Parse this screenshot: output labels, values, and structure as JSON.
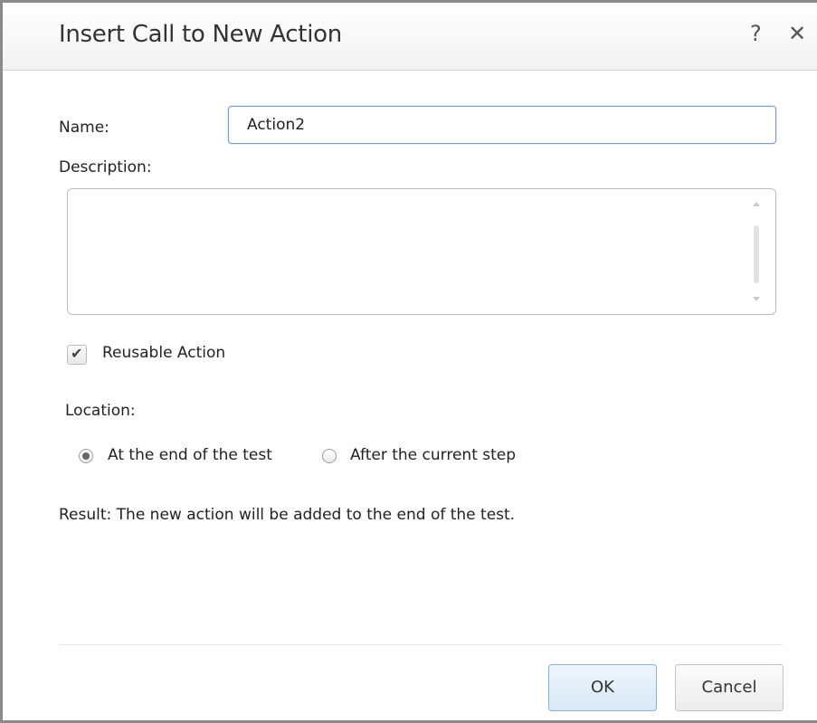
{
  "dialog": {
    "title": "Insert Call to New Action",
    "help_label": "?",
    "close_label": "✕"
  },
  "form": {
    "name_label": "Name:",
    "name_value": "Action2",
    "description_label": "Description:",
    "description_value": "",
    "reusable_label": "Reusable Action",
    "reusable_checked": true,
    "location_label": "Location:",
    "location_options": [
      {
        "label": "At the end of the test",
        "selected": true
      },
      {
        "label": "After the current step",
        "selected": false
      }
    ],
    "result_text": "Result: The new action will be added to the end of the test."
  },
  "buttons": {
    "ok_label": "OK",
    "cancel_label": "Cancel"
  },
  "icons": {
    "help": "question-icon",
    "close": "close-icon",
    "check": "checkmark-icon"
  }
}
